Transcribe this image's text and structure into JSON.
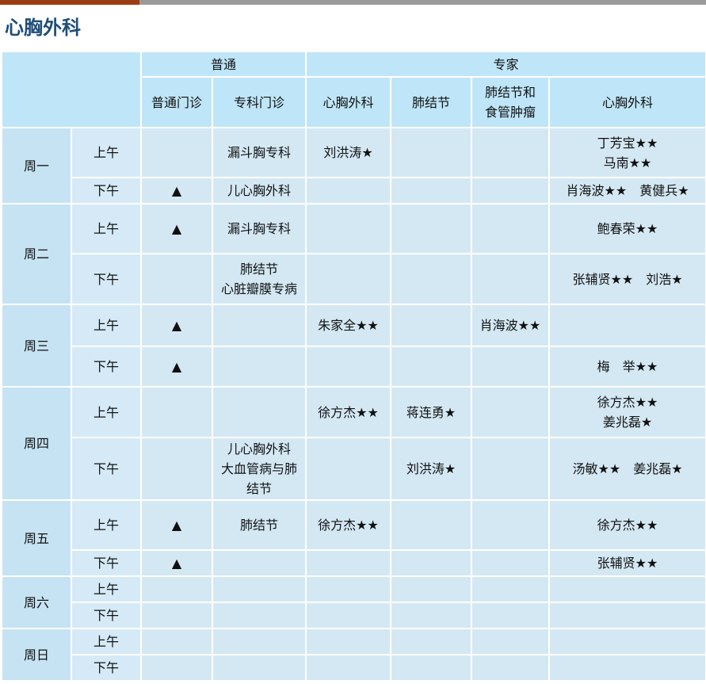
{
  "page": {
    "title": "心胸外科"
  },
  "header": {
    "general": "普通",
    "expert": "专家",
    "columns": [
      "普通门诊",
      "专科门诊",
      "心胸外科",
      "肺结节",
      "肺结节和食管肿瘤",
      "心胸外科"
    ],
    "col5_line1": "肺结节和",
    "col5_line2": "食管肿瘤"
  },
  "symbols": {
    "general_clinic": "▲",
    "star": "★"
  },
  "schedule": {
    "mon": {
      "day": "周一",
      "am": {
        "period": "上午",
        "general": "",
        "special": "漏斗胸专科",
        "thoracic": "刘洪涛★",
        "nodule": "",
        "esophageal": "",
        "cardio_l1": "丁芳宝★★",
        "cardio_l2": "马南★★"
      },
      "pm": {
        "period": "下午",
        "general": "▲",
        "special": "儿心胸外科",
        "thoracic": "",
        "nodule": "",
        "esophageal": "",
        "cardio": "肖海波★★　黄健兵★"
      }
    },
    "tue": {
      "day": "周二",
      "am": {
        "period": "上午",
        "general": "▲",
        "special": "漏斗胸专科",
        "thoracic": "",
        "nodule": "",
        "esophageal": "",
        "cardio": "鲍春荣★★"
      },
      "pm": {
        "period": "下午",
        "general": "",
        "special_l1": "肺结节",
        "special_l2": "心脏瓣膜专病",
        "thoracic": "",
        "nodule": "",
        "esophageal": "",
        "cardio": "张辅贤★★　刘浩★"
      }
    },
    "wed": {
      "day": "周三",
      "am": {
        "period": "上午",
        "general": "▲",
        "special": "",
        "thoracic": "朱家全★★",
        "nodule": "",
        "esophageal": "肖海波★★",
        "cardio": ""
      },
      "pm": {
        "period": "下午",
        "general": "▲",
        "special": "",
        "thoracic": "",
        "nodule": "",
        "esophageal": "",
        "cardio": "梅　举★★"
      }
    },
    "thu": {
      "day": "周四",
      "am": {
        "period": "上午",
        "general": "",
        "special": "",
        "thoracic": "徐方杰★★",
        "nodule": "蒋连勇★",
        "esophageal": "",
        "cardio_l1": "徐方杰★★",
        "cardio_l2": "姜兆磊★"
      },
      "pm": {
        "period": "下午",
        "general": "",
        "special_l1": "儿心胸外科",
        "special_l2": "大血管病与肺",
        "special_l3": "结节",
        "thoracic": "",
        "nodule": "刘洪涛★",
        "esophageal": "",
        "cardio": "汤敏★★　姜兆磊★"
      }
    },
    "fri": {
      "day": "周五",
      "am": {
        "period": "上午",
        "general": "▲",
        "special": "肺结节",
        "thoracic": "徐方杰★★",
        "nodule": "",
        "esophageal": "",
        "cardio": "徐方杰★★"
      },
      "pm": {
        "period": "下午",
        "general": "▲",
        "special": "",
        "thoracic": "",
        "nodule": "",
        "esophageal": "",
        "cardio": "张辅贤★★"
      }
    },
    "sat": {
      "day": "周六",
      "am": {
        "period": "上午"
      },
      "pm": {
        "period": "下午"
      }
    },
    "sun": {
      "day": "周日",
      "am": {
        "period": "上午"
      },
      "pm": {
        "period": "下午"
      }
    }
  },
  "colors": {
    "title": "#1f4e79",
    "header_bg": "#bfe6f8",
    "day_bg": "#c6e3f3",
    "period_bg": "#d5eaf6",
    "cell_bg": "#d4e8f4",
    "accent_bar": "#9b3d14",
    "grey_bar": "#9a9a9a"
  }
}
